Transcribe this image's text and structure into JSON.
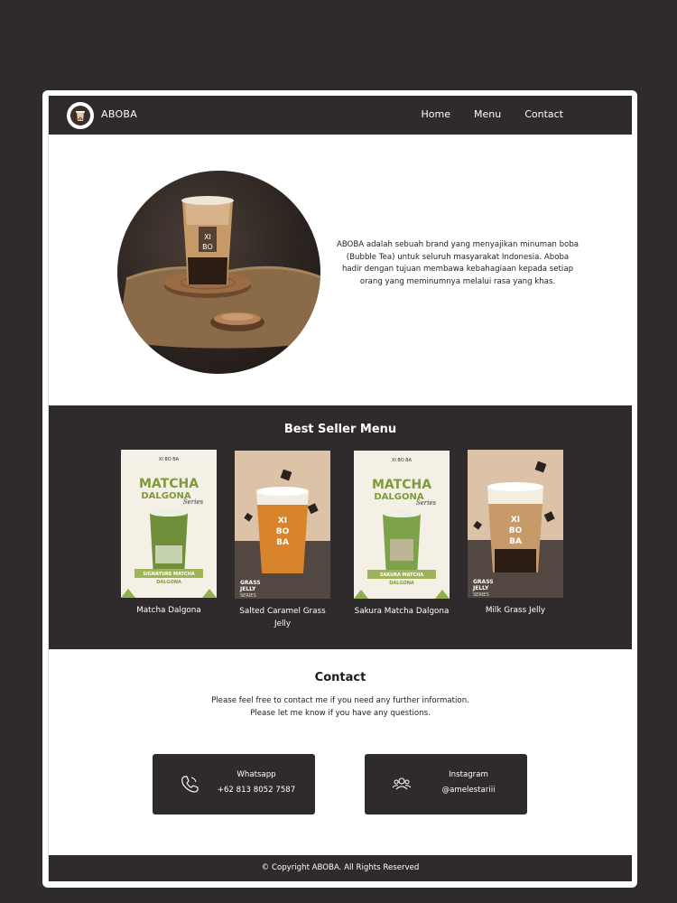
{
  "brand": {
    "name": "ABOBA"
  },
  "nav": {
    "items": [
      {
        "label": "Home"
      },
      {
        "label": "Menu"
      },
      {
        "label": "Contact"
      }
    ]
  },
  "hero": {
    "description": "ABOBA adalah sebuah brand yang menyajikan minuman boba (Bubble Tea) untuk seluruh masyarakat Indonesia. Aboba hadir dengan tujuan membawa kebahagiaan kepada setiap orang yang meminumnya melalui rasa yang khas."
  },
  "best_seller": {
    "title": "Best Seller Menu",
    "items": [
      {
        "name": "Matcha Dalgona",
        "poster_title": "MATCHA",
        "poster_sub": "DALGONA",
        "poster_series": "Series",
        "poster_label": "SIGNATURE MATCHA DALGONA"
      },
      {
        "name": "Salted Caramel Grass Jelly",
        "poster_label": "GRASS JELLY",
        "poster_series": "SERIES"
      },
      {
        "name": "Sakura Matcha Dalgona",
        "poster_title": "MATCHA",
        "poster_sub": "DALGONA",
        "poster_series": "Series",
        "poster_label": "SAKURA MATCHA DALGONA"
      },
      {
        "name": "Milk Grass Jelly",
        "poster_label": "GRASS JELLY",
        "poster_series": "SERIES"
      }
    ]
  },
  "contact": {
    "title": "Contact",
    "line1": "Please feel free to contact me if you need any further information.",
    "line2": "Please let me know if you have any questions.",
    "cards": [
      {
        "label": "Whatsapp",
        "value": "+62 813 8052 7587",
        "icon": "phone-icon"
      },
      {
        "label": "Instagram",
        "value": "@amelestariii",
        "icon": "people-icon"
      }
    ]
  },
  "footer": {
    "text": "© Copyright ABOBA. All Rights Reserved"
  },
  "colors": {
    "dark": "#2f2a2b",
    "matcha": "#7e9a3b",
    "caramel": "#c79a6a"
  }
}
